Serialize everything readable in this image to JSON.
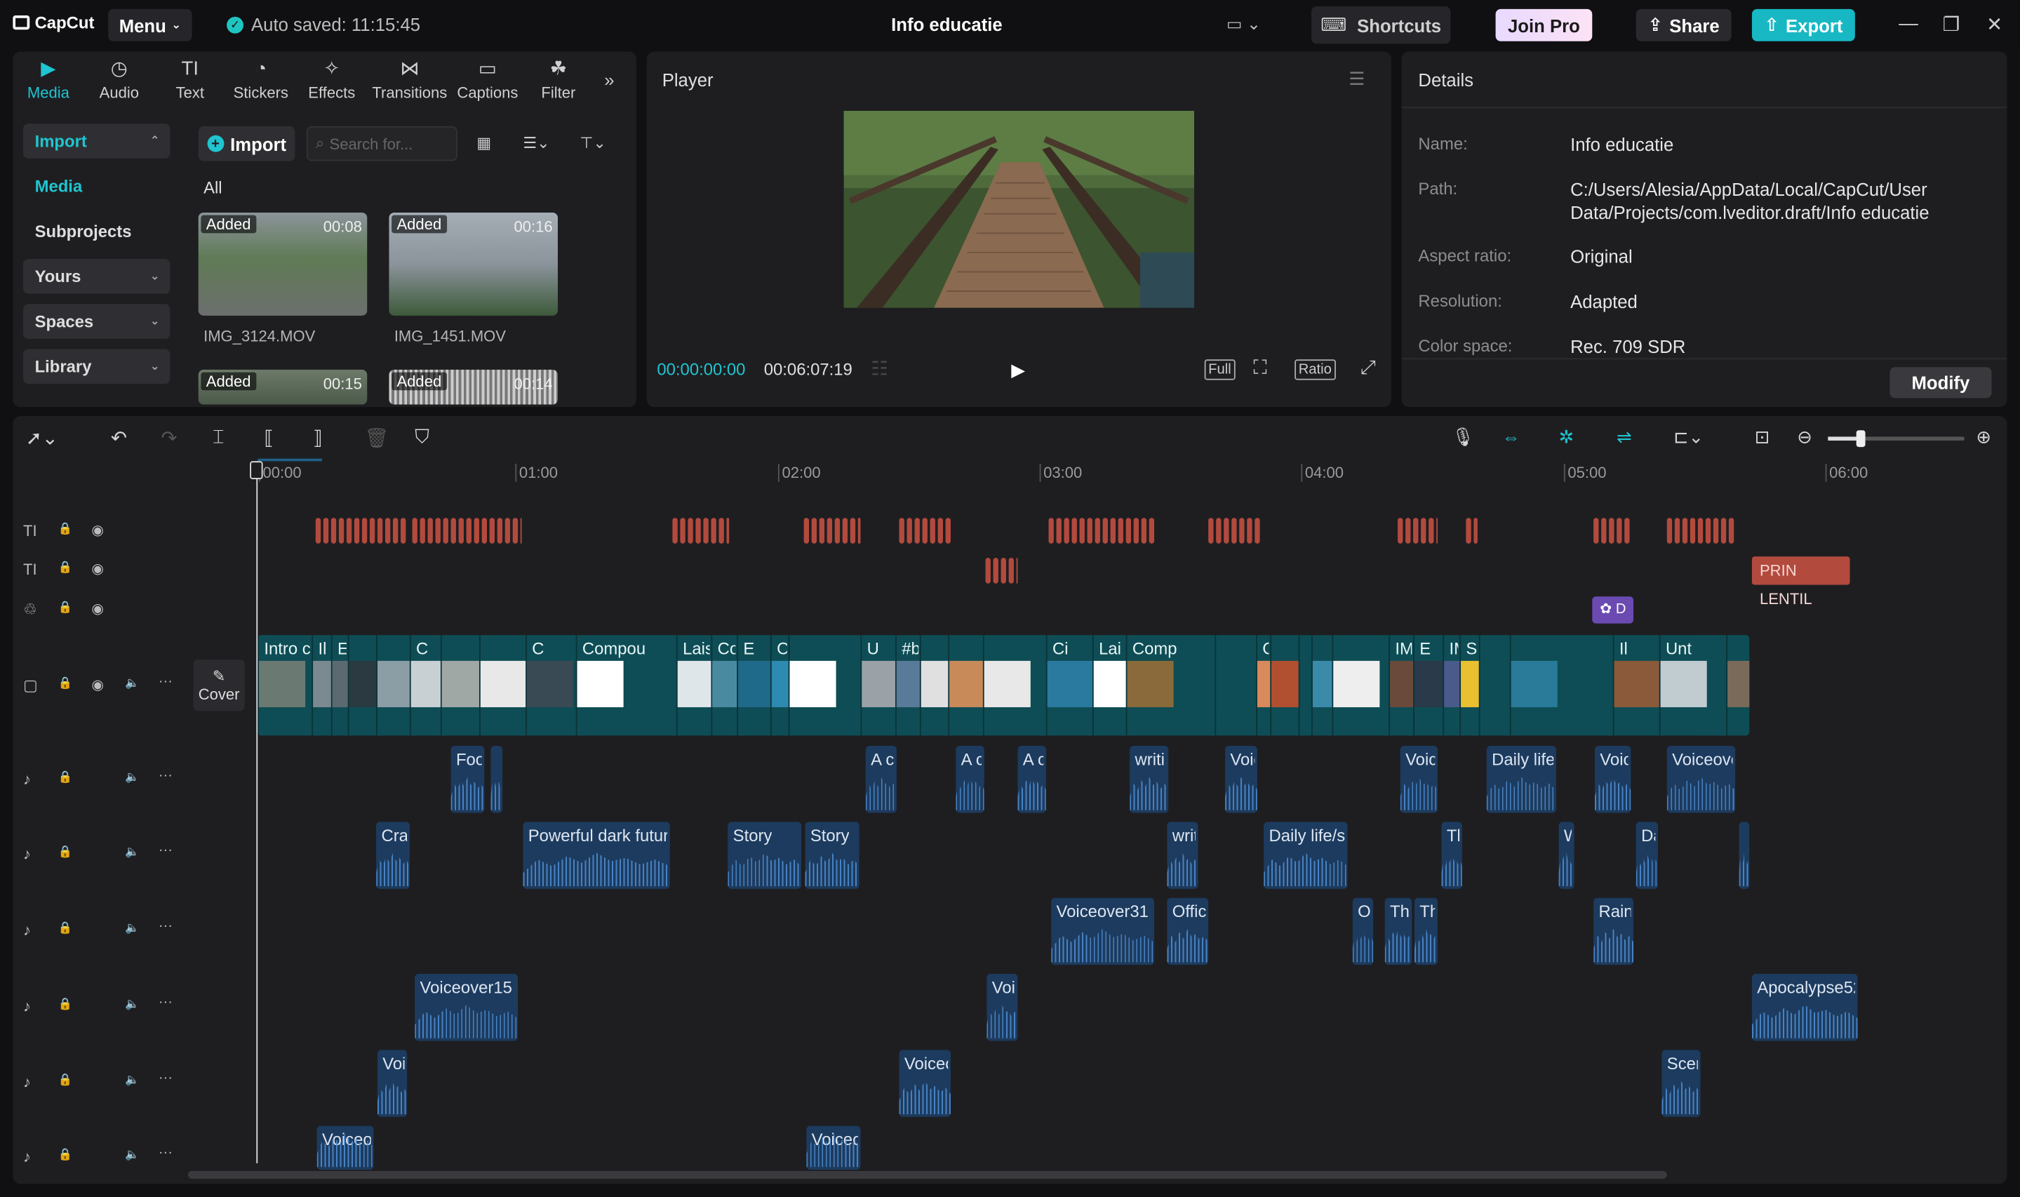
{
  "app": {
    "logo": "CapCut",
    "menu_label": "Menu",
    "autosave": "Auto saved: 11:15:45",
    "project_title": "Info educatie"
  },
  "header": {
    "shortcuts": "Shortcuts",
    "join_pro": "Join Pro",
    "share": "Share",
    "export": "Export"
  },
  "tabs": [
    {
      "label": "Media",
      "icon": "media-icon",
      "glyph": "▶"
    },
    {
      "label": "Audio",
      "icon": "audio-icon",
      "glyph": "◷"
    },
    {
      "label": "Text",
      "icon": "text-icon",
      "glyph": "TI"
    },
    {
      "label": "Stickers",
      "icon": "sticker-icon",
      "glyph": "◔"
    },
    {
      "label": "Effects",
      "icon": "effects-icon",
      "glyph": "✧"
    },
    {
      "label": "Transitions",
      "icon": "transitions-icon",
      "glyph": "⋈"
    },
    {
      "label": "Captions",
      "icon": "captions-icon",
      "glyph": "▭"
    },
    {
      "label": "Filter",
      "icon": "filter-icon",
      "glyph": "☘"
    }
  ],
  "leftnav": {
    "import": "Import",
    "media": "Media",
    "subprojects": "Subprojects",
    "yours": "Yours",
    "spaces": "Spaces",
    "library": "Library"
  },
  "media": {
    "import_btn": "Import",
    "search_placeholder": "Search for...",
    "filter_all": "All",
    "items": [
      {
        "name": "IMG_3124.MOV",
        "badge": "Added",
        "duration": "00:08"
      },
      {
        "name": "IMG_1451.MOV",
        "badge": "Added",
        "duration": "00:16"
      },
      {
        "name": "",
        "badge": "Added",
        "duration": "00:15"
      },
      {
        "name": "",
        "badge": "Added",
        "duration": "00:14"
      }
    ]
  },
  "player": {
    "title": "Player",
    "current": "00:00:00:00",
    "total": "00:06:07:19",
    "full": "Full",
    "ratio": "Ratio"
  },
  "details": {
    "title": "Details",
    "name_label": "Name:",
    "name": "Info educatie",
    "path_label": "Path:",
    "path": "C:/Users/Alesia/AppData/Local/CapCut/User Data/Projects/com.lveditor.draft/Info educatie",
    "aspect_label": "Aspect ratio:",
    "aspect": "Original",
    "resolution_label": "Resolution:",
    "resolution": "Adapted",
    "colorspace_label": "Color space:",
    "colorspace": "Rec. 709 SDR",
    "modify": "Modify"
  },
  "timeline": {
    "ruler": [
      "00:00",
      "01:00",
      "02:00",
      "03:00",
      "04:00",
      "05:00",
      "06:00"
    ],
    "cover": "Cover",
    "text_clip_label": "PRIN LENTIL",
    "effect_clip_label": "D",
    "video_clips": [
      "Intro c",
      "Il",
      "E",
      "",
      "",
      "C",
      "",
      "",
      "C",
      "Compou",
      "Lais",
      "Co",
      "E",
      "Comp",
      "",
      "U",
      "#b",
      "",
      "",
      "",
      "Ci",
      "Lai",
      "Comp",
      "",
      "C",
      "",
      "",
      "",
      "",
      "IM",
      "E",
      "IM",
      "S",
      "",
      "",
      "Il",
      "Unt",
      ""
    ],
    "audio_tracks": [
      [
        {
          "label": "Foo"
        },
        {
          "label": ""
        },
        {
          "label": "A cl"
        },
        {
          "label": "A c"
        },
        {
          "label": "A c"
        },
        {
          "label": "writi"
        },
        {
          "label": "Voic"
        },
        {
          "label": "Voic"
        },
        {
          "label": "Daily life,"
        },
        {
          "label": "Voic"
        },
        {
          "label": "Voiceove"
        }
      ],
      [
        {
          "label": "Crac"
        },
        {
          "label": "Powerful dark futuri"
        },
        {
          "label": "Story"
        },
        {
          "label": "Story"
        },
        {
          "label": "writ"
        },
        {
          "label": "Daily life/st"
        },
        {
          "label": "Th"
        },
        {
          "label": "W"
        },
        {
          "label": "Da"
        },
        {
          "label": ""
        }
      ],
      [
        {
          "label": "Voiceover31"
        },
        {
          "label": "Offic"
        },
        {
          "label": "Of"
        },
        {
          "label": "The"
        },
        {
          "label": "The"
        },
        {
          "label": "Rain"
        }
      ],
      [
        {
          "label": "Voiceover15"
        },
        {
          "label": "Voi"
        },
        {
          "label": "Apocalypse52"
        }
      ],
      [
        {
          "label": "Voi"
        },
        {
          "label": "Voiceo"
        },
        {
          "label": "Scen"
        }
      ],
      [
        {
          "label": "Voiceov"
        },
        {
          "label": "Voiceo"
        }
      ]
    ]
  },
  "colors": {
    "accent": "#1fc5d0",
    "text_clip": "#b24a3e",
    "video_track": "#0e4d55",
    "audio_clip": "#1d3b5e",
    "effect_clip": "#6b4ab2"
  }
}
